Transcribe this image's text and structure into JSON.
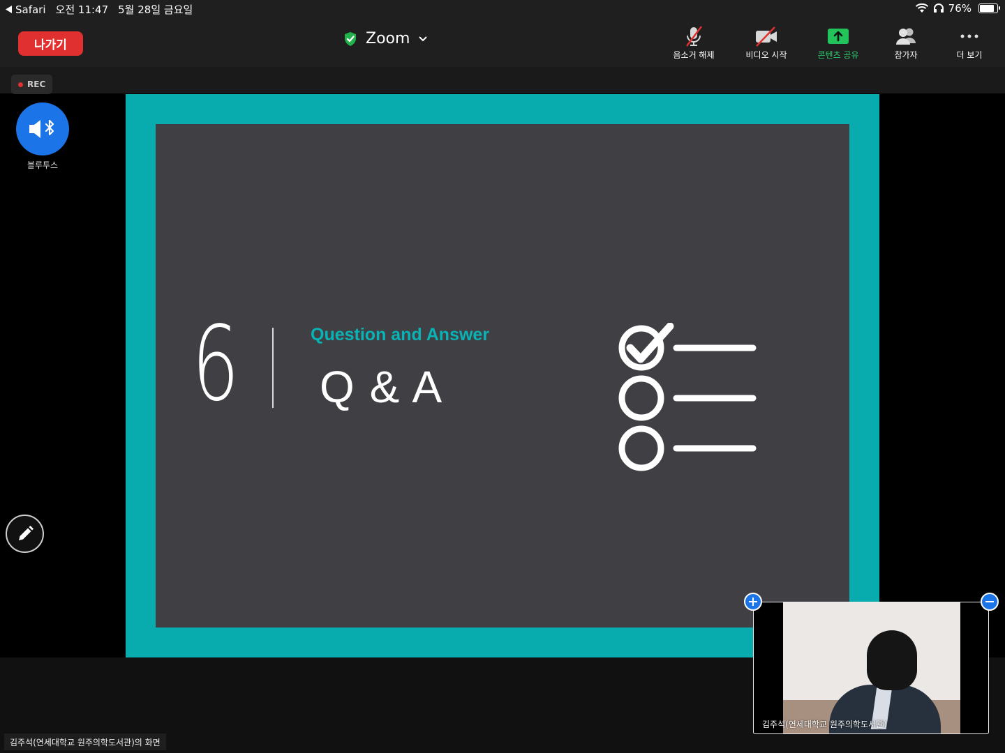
{
  "statusbar": {
    "back_app": "Safari",
    "time": "오전 11:47",
    "date": "5월 28일 금요일",
    "battery_percent": "76%",
    "battery_level": 0.76
  },
  "toolbar": {
    "leave_label": "나가기",
    "meeting_title": "Zoom",
    "unmute_label": "음소거 해제",
    "video_label": "비디오 시작",
    "share_label": "콘텐츠 공유",
    "participants_label": "참가자",
    "more_label": "더 보기"
  },
  "recording": {
    "label": "REC"
  },
  "audio": {
    "label": "블루투스"
  },
  "slide": {
    "number": "6",
    "subtitle": "Question and Answer",
    "title": "Q & A"
  },
  "screen_owner_label": "김주석(연세대학교 원주의학도서관)의 화면",
  "self_view": {
    "name": "김주석(연세대학교 원주의학도서관)"
  },
  "colors": {
    "slide_teal": "#08acae",
    "slide_bg": "#3f3f44",
    "leave_red": "#e0302f",
    "share_green": "#2ecc71",
    "zoom_blue": "#1b74e8"
  }
}
